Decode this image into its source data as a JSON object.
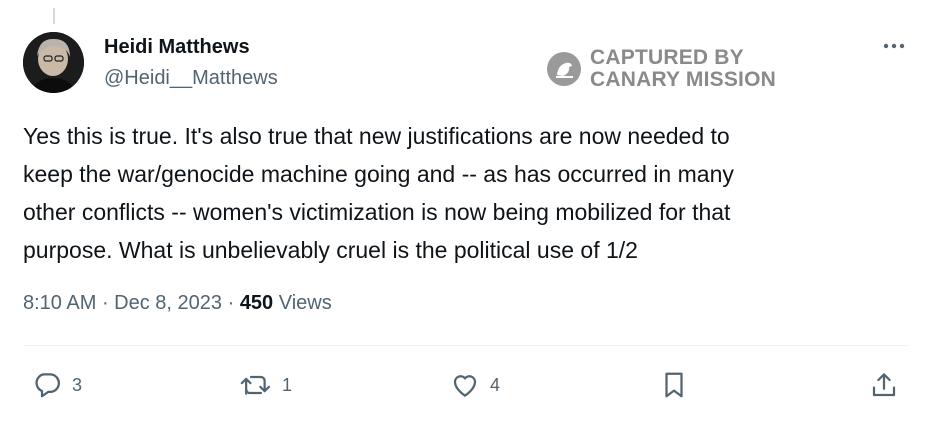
{
  "author": {
    "name": "Heidi Matthews",
    "handle": "@Heidi__Matthews"
  },
  "watermark": {
    "line1": "CAPTURED BY",
    "line2": "CANARY MISSION"
  },
  "tweet": {
    "text": "Yes this is true. It's also true that new justifications are now needed to\nkeep the war/genocide machine going and -- as has occurred in many\nother conflicts -- women's victimization is now being mobilized for that\npurpose. What is unbelievably cruel is the political use of 1/2"
  },
  "meta": {
    "time": "8:10 AM",
    "separator": " · ",
    "date": "Dec 8, 2023",
    "views_count": "450",
    "views_label": " Views"
  },
  "actions": {
    "replies": "3",
    "reposts": "1",
    "likes": "4"
  },
  "colors": {
    "secondary_text": "#536471",
    "primary_text": "#0f1419",
    "watermark_gray": "#8a8a8a",
    "divider": "#eff3f4"
  },
  "icons": [
    "more-icon",
    "reply-icon",
    "repost-icon",
    "like-icon",
    "bookmark-icon",
    "share-icon",
    "canary-logo-icon"
  ]
}
